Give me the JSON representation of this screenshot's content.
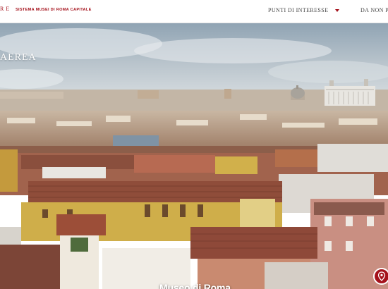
{
  "header": {
    "logo_fragment": "RE",
    "site_name": "SISTEMA MUSEI DI ROMA CAPITALE",
    "nav": [
      {
        "label": "PUNTI DI INTERESSE"
      },
      {
        "label": "DA NON PE"
      }
    ]
  },
  "hero": {
    "label": "AEREA",
    "title": "Museo di Roma"
  },
  "icons": {
    "nav_caret": "chevron-down-icon",
    "map_pin": "map-pin-icon"
  },
  "colors": {
    "brand": "#a5121c",
    "sky_top": "#8fa3b3",
    "sky_bottom": "#cfd7dd",
    "terracotta": "#b5674e",
    "ochre": "#d9b64f"
  }
}
